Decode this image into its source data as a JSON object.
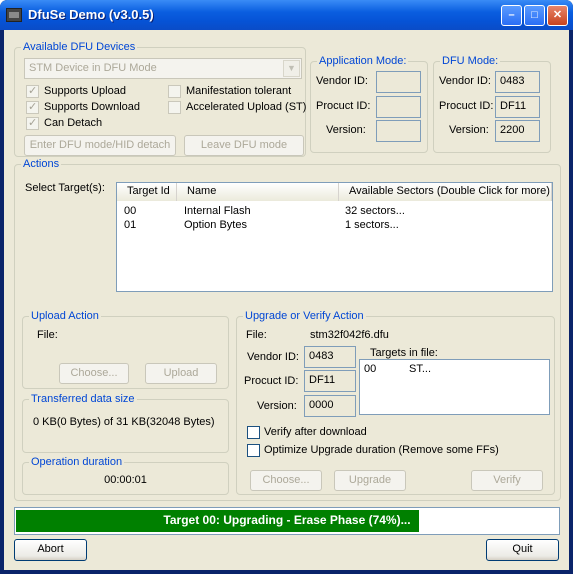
{
  "window": {
    "title": "DfuSe Demo (v3.0.5)"
  },
  "devices": {
    "legend": "Available DFU Devices",
    "combo_value": "STM Device in DFU Mode",
    "supports_upload": "Supports Upload",
    "supports_download": "Supports Download",
    "can_detach": "Can Detach",
    "manifestation": "Manifestation tolerant",
    "accelerated": "Accelerated Upload (ST)",
    "enter_btn": "Enter DFU mode/HID detach",
    "leave_btn": "Leave DFU mode"
  },
  "app_mode": {
    "legend": "Application Mode:",
    "vendor_label": "Vendor ID:",
    "product_label": "Procuct ID:",
    "version_label": "Version:",
    "vendor": "",
    "product": "",
    "version": ""
  },
  "dfu_mode": {
    "legend": "DFU Mode:",
    "vendor_label": "Vendor ID:",
    "product_label": "Procuct ID:",
    "version_label": "Version:",
    "vendor": "0483",
    "product": "DF11",
    "version": "2200"
  },
  "actions": {
    "legend": "Actions",
    "select_label": "Select Target(s):",
    "columns": [
      "Target Id",
      "Name",
      "Available Sectors (Double Click for more)"
    ],
    "rows": [
      {
        "id": "00",
        "name": "Internal Flash",
        "sectors": "32 sectors..."
      },
      {
        "id": "01",
        "name": "Option Bytes",
        "sectors": "1 sectors..."
      }
    ]
  },
  "upload": {
    "legend": "Upload Action",
    "file_label": "File:",
    "choose_btn": "Choose...",
    "upload_btn": "Upload"
  },
  "transferred": {
    "legend": "Transferred data size",
    "value": "0 KB(0 Bytes) of 31 KB(32048 Bytes)"
  },
  "duration": {
    "legend": "Operation duration",
    "value": "00:00:01"
  },
  "upgrade": {
    "legend": "Upgrade or Verify Action",
    "file_label": "File:",
    "file": "stm32f042f6.dfu",
    "vendor_label": "Vendor ID:",
    "product_label": "Procuct ID:",
    "version_label": "Version:",
    "vendor": "0483",
    "product": "DF11",
    "version": "0000",
    "targets_label": "Targets in file:",
    "target_id": "00",
    "target_name": "ST...",
    "verify_after": "Verify after download",
    "optimize": "Optimize Upgrade duration (Remove some FFs)",
    "choose_btn": "Choose...",
    "upgrade_btn": "Upgrade",
    "verify_btn": "Verify"
  },
  "progress": {
    "text": "Target 00: Upgrading - Erase Phase (74%)...",
    "percent": 74
  },
  "footer": {
    "abort_btn": "Abort",
    "quit_btn": "Quit"
  }
}
